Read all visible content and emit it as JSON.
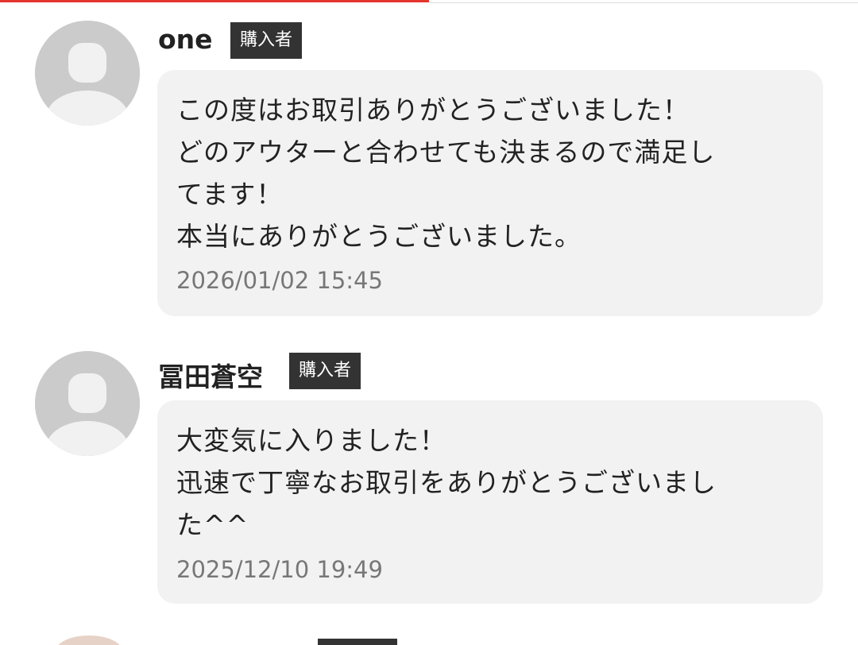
{
  "reviews": [
    {
      "reviewer_name": "one",
      "role_badge": "購入者",
      "comment": "この度はお取引ありがとうございました！\nどのアウターと合わせても決まるので満足し\nてます！\n本当にありがとうございました。",
      "timestamp": "2026/01/02 15:45",
      "avatar_icon": "default-user-avatar-icon"
    },
    {
      "reviewer_name": "冨田蒼空",
      "role_badge": "購入者",
      "comment": "大変気に入りました！\n迅速で丁寧なお取引をありがとうございまし\nた^^",
      "timestamp": "2025/12/10 19:49",
      "avatar_icon": "default-user-avatar-icon"
    }
  ],
  "colors": {
    "accent_progress": "#e5352f",
    "badge_background": "#333333",
    "bubble_background": "#f2f2f2",
    "avatar_placeholder": "#cbcbcb"
  }
}
